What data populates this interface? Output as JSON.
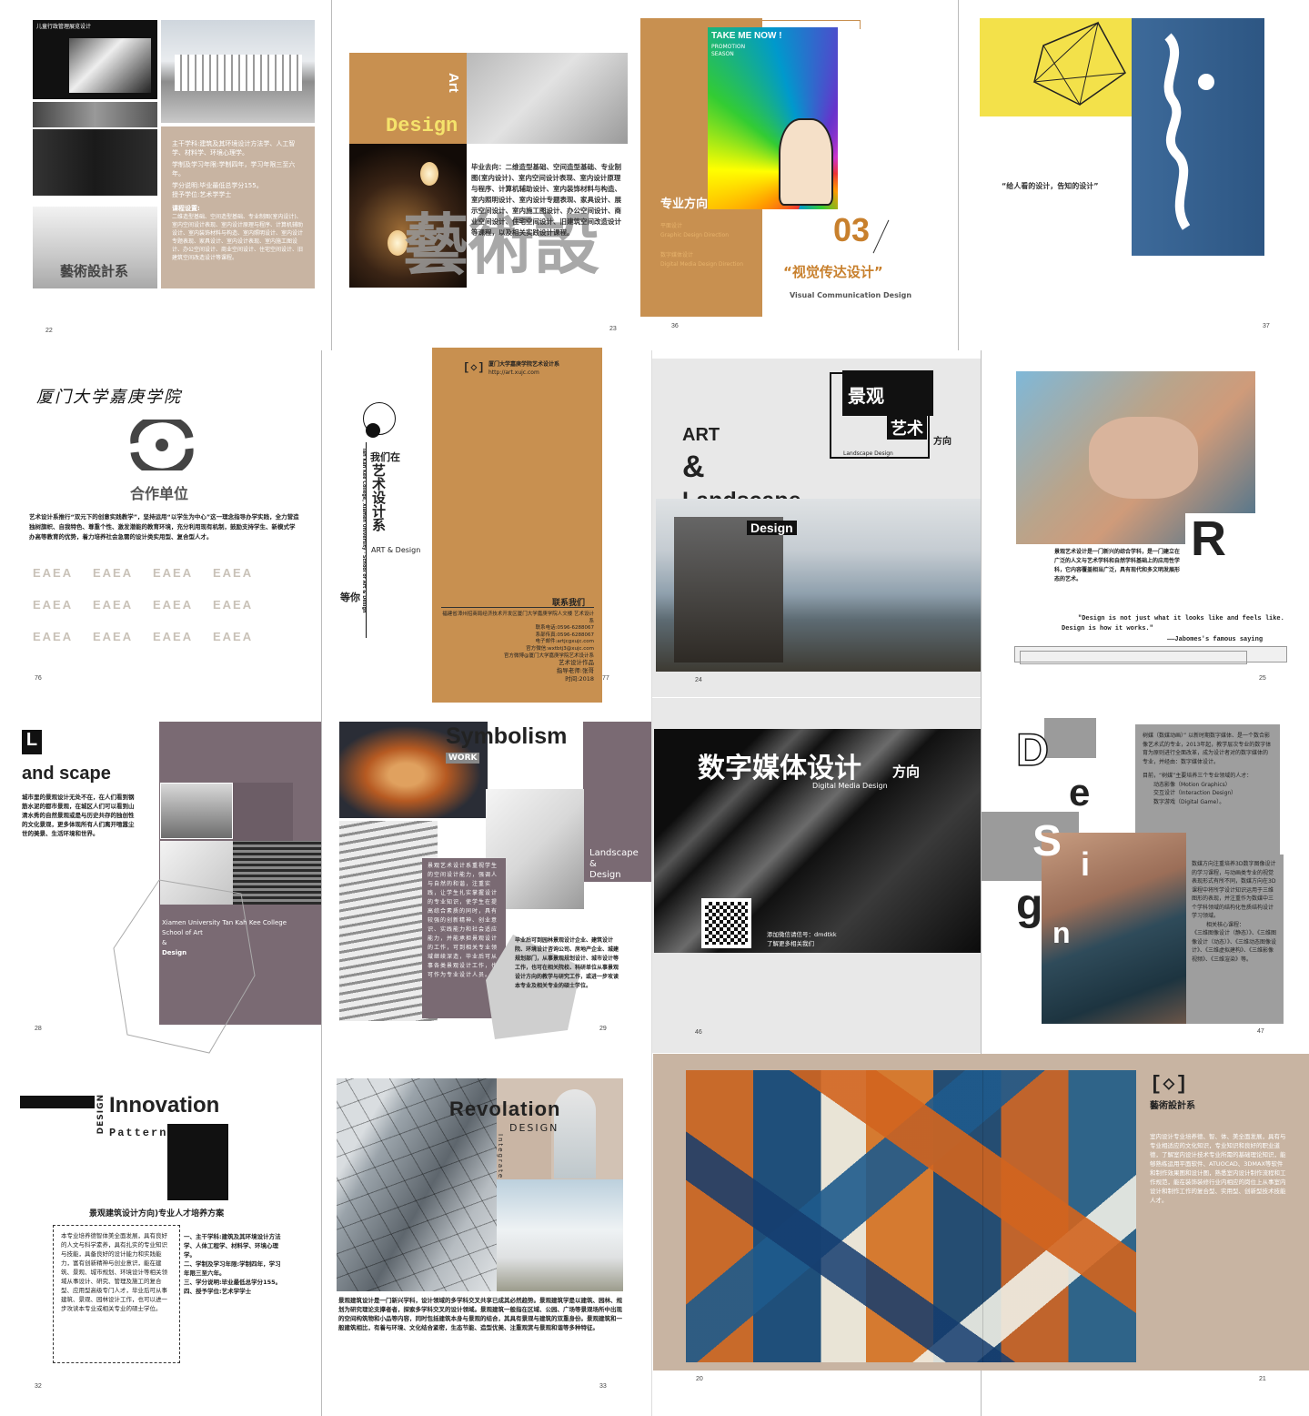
{
  "pages": {
    "p22": {
      "num": "22",
      "photo_title": "儿童行政管理展览设计",
      "logo_text": "藝術設計系",
      "lines": [
        "主干学科:建筑及其环境设计方法学、人工智学、材料学、环境心理学。",
        "学制及学习年限:学制四年，学习年限三至六年。",
        "学分说明:毕业最低总学分155。",
        "授予学位:艺术学学士",
        "课程设置:",
        "二维造型基础、空间造型基础、专业制图(室内设计)、室内空间设计表现、室内设计原理与程序、计算机辅助设计、室内装饰材料与构造、室内照明设计、室内设计专题表现、家具设计、室内设计表现、室内施工图设计、办公空间设计、商业空间设计、住宅空间设计、旧建筑空间改造设计等课程。"
      ]
    },
    "p23": {
      "num": "23",
      "art": "Art",
      "design": "Design",
      "big_chars": "藝術設",
      "text": "毕业去向：二维造型基础、空间造型基础、专业制图(室内设计)、室内空间设计表现、室内设计原理与程序、计算机辅助设计、室内装饰材料与构造、室内照明设计、室内设计专题表现、家具设计、展示空间设计、室内施工图设计、办公空间设计、商业空间设计、住宅空间设计、旧建筑空间改造设计等课程，以及相关实践设计课程。"
    },
    "p36": {
      "num": "36",
      "poster1": "TAKE ME NOW !",
      "poster2": "PROMOTION",
      "poster3": "SEASON",
      "dir": "专业方向",
      "sub1": "平面设计",
      "sub1b": "Graphic Design Direction",
      "sub2": "数字媒体设计",
      "sub2b": "Digital Media Design Direction",
      "n03": "03",
      "title": "“视觉传达设计”",
      "en": "Visual Communication Design"
    },
    "p37": {
      "num": "37",
      "quote": "“给人看的设计，告知的设计”"
    },
    "p76": {
      "num": "76",
      "calligraphy": "厦门大学嘉庚学院",
      "partner": "合作单位",
      "text": "艺术设计系推行“双元下的创意实践教学”，坚持运用“以学生为中心”这一理念指导办学实践，全力营造独树旗帜、自我特色、尊重个性、激发潜能的教育环境，充分利用现有机制，鼓励支持学生、新模式学办高等教育的优势，着力培养社会急需的设计类实用型、复合型人才。",
      "logos": [
        "EAEA",
        "EAEA",
        "EAEA",
        "EAEA",
        "EAEA",
        "EAEA",
        "EAEA",
        "EAEA",
        "EAEA",
        "EAEA",
        "EAEA",
        "EAEA"
      ]
    },
    "p77": {
      "num": "77",
      "we": "我们在",
      "dept": "艺术设计系",
      "en": "ART & Design",
      "wait": "等你",
      "vert": "Tan Kah Kee College, Xiamen University · School of Art & Design",
      "header": "厦门大学嘉庚学院艺术设计系",
      "url": "http://art.xujc.com",
      "contact": "联系我们",
      "contact_lines": [
        "福建省漳州招商局经济技术开发区厦门大学嘉庚学院人文楼 艺术设计系",
        "联系电话:0596-6288067",
        "系部传真:0596-6288067",
        "电子邮件:artjcgxujc.com",
        "官方微信:wxtbtj3@xujc.com",
        "官方微博@厦门大学嘉庚学院艺术设计系"
      ],
      "foot": [
        "艺术设计作品",
        "指导老师:张哥",
        "时间:2018"
      ]
    },
    "p24": {
      "num": "24",
      "jg": "景观",
      "ys": "艺术",
      "fx": "方向",
      "ld": "Landscape Design",
      "art": "ART",
      "amp": "&",
      "land": "Landscape",
      "des": "Design"
    },
    "p25": {
      "num": "25",
      "r": "R",
      "text": "景观艺术设计是一门新兴的综合学科，是一门建立在广泛的人文与艺术学科和自然学科基础上的应用性学科，它内容覆盖相当广泛，具有现代和多文明发展形态的艺术。",
      "quote1": "\"Design is not just what it looks like and feels like.",
      "quote2": "Design is how it works.\"",
      "author": "——Jabomes's famous saying"
    },
    "p28": {
      "num": "28",
      "L": "L",
      "title": "and scape",
      "text": "城市里的景观设计无处不在，在人们看到钢筋水泥的都市景观，在城区人们可以看到山清水秀的自然景观或是与历史共存的独创性的文化景观，更多体现所有人们离开喧嚣尘世的美景、生活环境和世界。",
      "school1": "Xiamen University Tan Kah Kee College",
      "school2": "School of Art",
      "school3": "&",
      "school4": "Design"
    },
    "p29": {
      "num": "29",
      "title": "Symbolism",
      "work": "WORK",
      "ld1": "Landscape",
      "ld2": "&",
      "ld3": "Design",
      "text1": "景观艺术设计系重视学生的空间设计能力，强调人与自然的和谐，注重实践，让学生扎实掌握设计的专业知识，使学生在提高综合素质的同时，具有较强的创新精神、创业意识、实践能力和社会适应能力，并能承担景观设计的工作，可到相关专业领域继续深造，毕业后可从事各类景观设计工作，也可作为专业设计人员。",
      "text2": "毕业后可到园林景观设计企业、建筑设计院、环境设计咨询公司、房地产企业、城建规划部门，从事景观规划设计、城市设计等工作，也可在相关院校、科研单位从事景观设计方向的教学与研究工作，或进一步攻读本专业及相关专业的硕士学位。"
    },
    "p46": {
      "num": "46",
      "title": "数字媒体设计",
      "fx": "方向",
      "en": "Digital Media Design",
      "wx": "添加微信请信号：dmdtkk",
      "wx2": "了解更多相关我们"
    },
    "p47": {
      "num": "47",
      "letters": [
        "D",
        "e",
        "S",
        "i",
        "g",
        "n"
      ],
      "text1": "树媒（数媒动画）” 以新时期数字媒体、是一个数合影像艺术式的专业，2013年起，教学层次专业的数字体育为原则进行全面改革，成为设计者对的数字媒体的专业，并经由：数字媒体设计。",
      "text2": "目前，“树媒”主要培养三个专业领域的人才：",
      "list": [
        "动态影像（Motion Graphics）",
        "交互设计（Interaction Design）",
        "数字游戏（Digital Game）。"
      ],
      "text3": "数媒方向注重培养3D数字图像设计的学习课程，与动画类专业的视觉表现形式有所不同，数媒方向在3D课程中将所学设计知识运用于三维图形的表现，并注重作为数媒中三个学科领域的结构化性质结构设计学习领域。",
      "courses_title": "相关核心课程：",
      "courses": "《三维图像设计（静态）》、《三维图像设计（动态）》、《三维动态图像设计》、《三维虚拟建构》、《三维影像视频》、《三维渲染》等。"
    },
    "p32": {
      "num": "32",
      "design": "DESIGN",
      "innovation": "Innovation",
      "pattern": "Pattern",
      "heading": "景观建筑设计方向)专业人才培养方案",
      "box": "本专业培养德智体美全面发展，具有良好的人文与科学素养，具有扎实的专业知识与技能，具备良好的设计能力和实践能力，富有创新精神与创业意识，能在建筑、景观、城市规划、环境设计等相关领域从事设计、研究、管理及施工的复合型、应用型高级专门人才，毕业后可从事建筑、景观、园林设计工作，也可以进一步攻读本专业或相关专业的硕士学位。",
      "items": [
        "一、主干学科:建筑及其环境设计方法学、人体工程学、材料学、环境心理学。",
        "二、学制及学习年限:学制四年，学习年限三至六年。",
        "三、学分说明:毕业最低总学分155。",
        "四、授予学位:艺术学学士"
      ]
    },
    "p33": {
      "num": "33",
      "title": "Revolation",
      "design": "DESIGN",
      "vert": "Integrate",
      "text": "景观建筑设计是一门新兴学科，设计领域的多学科交叉共享已成其必然趋势。景观建筑学是以建筑、园林、规划为研究理论支撑者者，探索多学科交叉的设计领域。景观建筑一般指在区域、公园、广场等景观场所中出现的空间构筑物和小品等内容，同时包括建筑本身与景观的结合，其具有景观与建筑的双重身份。景观建筑和一般建筑相比，有着与环境、文化结合紧密，生态节能、造型优美、注重观赏与景观和谐等多种特征。"
    },
    "p20": {
      "num": "20"
    },
    "p21": {
      "num": "21",
      "logo": "[◇]",
      "brand": "藝術設計系",
      "text": "室内设计专业培养德、智、体、美全面发展，具有与专业相适应的文化知识，专业知识和良好的职业道德，了解室内设计技术专业所需的基础理论知识，能够熟练运用平面软件、ATUOCAD、3DMAX等软件和制作效果图和设计图，熟悉室内设计制作流程和工作规范，能在装饰装修行业内相应的岗位上从事室内设计和制作工作的复合型、实用型、创新型技术技能人才。"
    }
  },
  "colors": {
    "brown": "#c89050",
    "taupe": "#7a6a73",
    "beige": "#c8b4a2",
    "black": "#111111",
    "grey": "#9b9b9b"
  }
}
